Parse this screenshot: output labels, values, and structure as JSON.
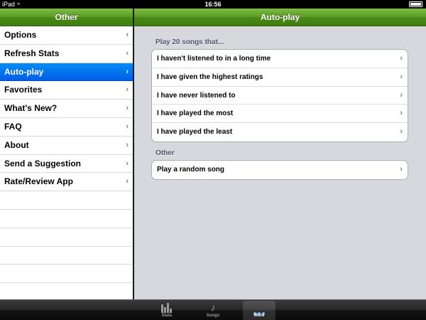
{
  "status_bar": {
    "carrier": "iPad",
    "time": "16:56"
  },
  "master": {
    "title": "Other",
    "items": [
      {
        "label": "Options"
      },
      {
        "label": "Refresh Stats"
      },
      {
        "label": "Auto-play",
        "selected": true
      },
      {
        "label": "Favorites"
      },
      {
        "label": "What's New?"
      },
      {
        "label": "FAQ"
      },
      {
        "label": "About"
      },
      {
        "label": "Send a Suggestion"
      },
      {
        "label": "Rate/Review App"
      }
    ]
  },
  "detail": {
    "title": "Auto-play",
    "sections": [
      {
        "header": "Play 20 songs that...",
        "rows": [
          "I haven't listened to in a long time",
          "I have given the highest ratings",
          "I have never listened to",
          "I have played the most",
          "I have played the least"
        ]
      },
      {
        "header": "Other",
        "rows": [
          "Play a random song"
        ]
      }
    ]
  },
  "chevron": "›",
  "tabbar": {
    "tabs": [
      {
        "label": "Stats",
        "icon": "bar-chart-icon"
      },
      {
        "label": "Songs",
        "icon": "music-note-icon"
      },
      {
        "label": "More",
        "icon": "more-dots-icon",
        "active": true
      }
    ]
  },
  "colors": {
    "navbar_green": "#5b9a23",
    "selection_blue": "#015de6",
    "detail_background": "#d6d8de"
  }
}
